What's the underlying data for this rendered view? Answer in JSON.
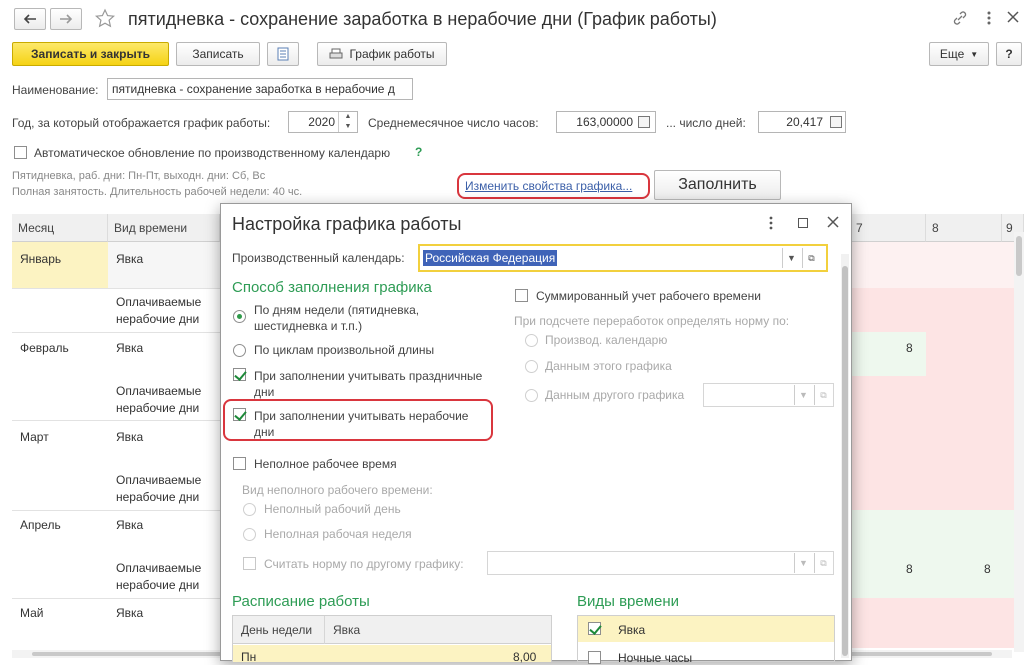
{
  "window": {
    "title": "пятидневка - сохранение заработка в нерабочие дни (График работы)"
  },
  "toolbar": {
    "save_close": "Записать и закрыть",
    "save": "Записать",
    "schedule": "График работы",
    "more": "Еще",
    "help": "?"
  },
  "form": {
    "name_label": "Наименование:",
    "name_value": "пятидневка - сохранение заработка в нерабочие д",
    "year_label": "Год, за который отображается график работы:",
    "year_value": "2020",
    "avg_hours_label": "Среднемесячное число часов:",
    "avg_hours_value": "163,00000",
    "days_label": "... число дней:",
    "days_value": "20,417",
    "auto_update_label": "Автоматическое обновление по производственному календарю",
    "help_mark": "?",
    "info_line1": "Пятидневка, раб. дни: Пн-Пт, выходн. дни: Сб, Вс",
    "info_line2": "Полная занятость. Длительность рабочей недели: 40 чс.",
    "change_link": "Изменить свойства графика...",
    "fill_button": "Заполнить"
  },
  "table": {
    "col_month": "Месяц",
    "col_type": "Вид времени",
    "col_7": "7",
    "col_8": "8",
    "col_9": "9",
    "rows": [
      {
        "month": "Январь",
        "type": "Явка",
        "v7": "",
        "v8": ""
      },
      {
        "month": "",
        "type": "Оплачиваемые нерабочие дни",
        "v7": "",
        "v8": ""
      },
      {
        "month": "Февраль",
        "type": "Явка",
        "v7": "8",
        "v8": ""
      },
      {
        "month": "",
        "type": "Оплачиваемые нерабочие дни",
        "v7": "",
        "v8": ""
      },
      {
        "month": "Март",
        "type": "Явка",
        "v7": "",
        "v8": ""
      },
      {
        "month": "",
        "type": "Оплачиваемые нерабочие дни",
        "v7": "",
        "v8": ""
      },
      {
        "month": "Апрель",
        "type": "Явка",
        "v7": "",
        "v8": ""
      },
      {
        "month": "",
        "type": "Оплачиваемые нерабочие дни",
        "v7": "8",
        "v8": "8"
      },
      {
        "month": "Май",
        "type": "Явка",
        "v7": "",
        "v8": ""
      }
    ]
  },
  "dialog": {
    "title": "Настройка графика работы",
    "calendar_label": "Производственный календарь:",
    "calendar_value": "Российская Федерация",
    "fill_method_title": "Способ заполнения графика",
    "radio_weekdays": "По дням недели (пятидневка, шестидневка и т.п.)",
    "radio_cycles": "По циклам произвольной длины",
    "chk_holidays": "При заполнении учитывать праздничные дни",
    "chk_nonworking": "При заполнении учитывать нерабочие дни",
    "chk_parttime": "Неполное рабочее время",
    "parttime_kind_label": "Вид неполного рабочего времени:",
    "radio_partday": "Неполный рабочий день",
    "radio_partweek": "Неполная рабочая неделя",
    "chk_norm_other": "Считать норму по другому графику:",
    "chk_summary": "Суммированный учет рабочего времени",
    "overtime_label": "При подсчете переработок определять норму по:",
    "radio_prod_cal": "Производ. календарю",
    "radio_this_sched": "Данным этого графика",
    "radio_other_sched": "Данным другого графика",
    "schedule_title": "Расписание работы",
    "sched_col_day": "День недели",
    "sched_col_attend": "Явка",
    "sched_row_day": "Пн",
    "sched_row_value": "8,00",
    "time_types_title": "Виды времени",
    "time_type_1": "Явка",
    "time_type_2": "Ночные часы"
  },
  "colors": {
    "accent_green": "#2e9c55",
    "highlight_red": "#d9363e",
    "selection_yellow": "#fcf3c2",
    "holiday_pink": "#fde4e4",
    "work_green": "#eef8ee"
  }
}
